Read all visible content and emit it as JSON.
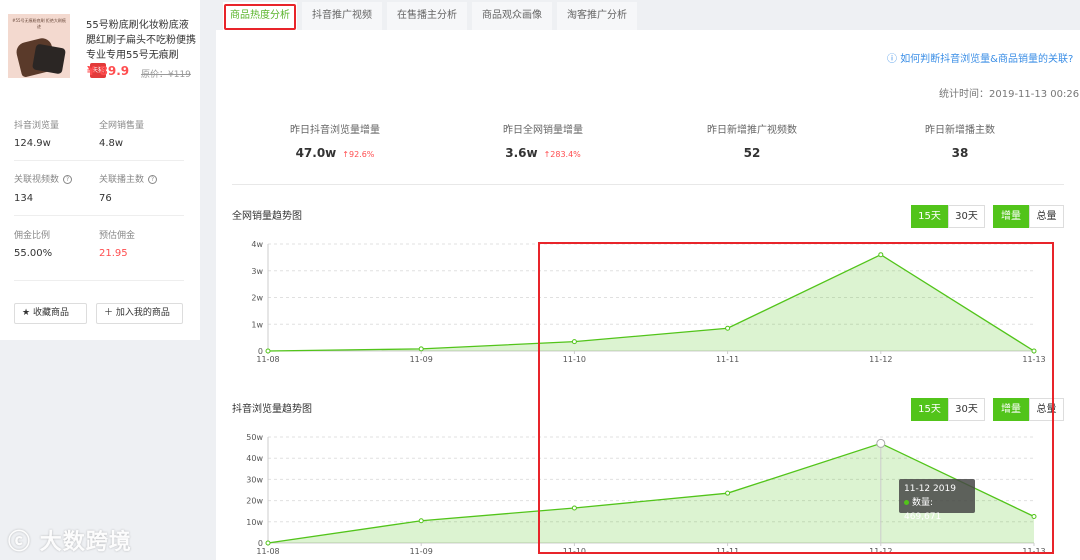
{
  "product": {
    "title": "55号粉底刷化妆粉底液腮红刷子扁头不吃粉便携专业专用55号无痕刷",
    "badge": "天猫",
    "thumb_caption": "#55号无痕粉底刷 拒绝大刷痕迹",
    "price": "¥ 89.9",
    "original_price": "原价：¥119"
  },
  "stats": [
    {
      "label": "抖音浏览量",
      "value": "124.9w"
    },
    {
      "label": "全网销售量",
      "value": "4.8w"
    },
    {
      "label": "关联视频数",
      "value": "134"
    },
    {
      "label": "关联播主数",
      "value": "76"
    },
    {
      "label": "佣金比例",
      "value": "55.00%"
    },
    {
      "label": "预估佣金",
      "value": "21.95"
    }
  ],
  "actions": {
    "favorite": "收藏商品",
    "add": "加入我的商品"
  },
  "tabs": [
    "商品热度分析",
    "抖音推广视频",
    "在售播主分析",
    "商品观众画像",
    "淘客推广分析"
  ],
  "help_link": "如何判断抖音浏览量&商品销量的关联?",
  "stat_time": "统计时间：2019-11-13 00:26",
  "kpis": [
    {
      "label": "昨日抖音浏览量增量",
      "value": "47.0w",
      "change": "↑92.6%"
    },
    {
      "label": "昨日全网销量增量",
      "value": "3.6w",
      "change": "↑283.4%"
    },
    {
      "label": "昨日新增推广视频数",
      "value": "52",
      "change": ""
    },
    {
      "label": "昨日新增播主数",
      "value": "38",
      "change": ""
    }
  ],
  "controls": {
    "d15": "15天",
    "d30": "30天",
    "inc": "增量",
    "total": "总量"
  },
  "chart_data": [
    {
      "type": "area",
      "title": "全网销量趋势图",
      "x": [
        "11-08",
        "11-09",
        "11-10",
        "11-11",
        "11-12",
        "11-13"
      ],
      "values": [
        0,
        800,
        3500,
        8500,
        36000,
        0
      ],
      "ylim": [
        0,
        40000
      ],
      "yticks": [
        "0",
        "1w",
        "2w",
        "3w",
        "4w"
      ],
      "grid": true,
      "color": "#52c41a"
    },
    {
      "type": "area",
      "title": "抖音浏览量趋势图",
      "x": [
        "11-08",
        "11-09",
        "11-10",
        "11-11",
        "11-12",
        "11-13"
      ],
      "values": [
        0,
        105000,
        165000,
        235000,
        469671,
        125000
      ],
      "ylim": [
        0,
        500000
      ],
      "yticks": [
        "0",
        "10w",
        "20w",
        "30w",
        "40w",
        "50w"
      ],
      "grid": true,
      "color": "#52c41a",
      "tooltip": {
        "title": "11-12 2019",
        "label": "数量: 469,671"
      }
    }
  ],
  "watermark": "大数跨境"
}
